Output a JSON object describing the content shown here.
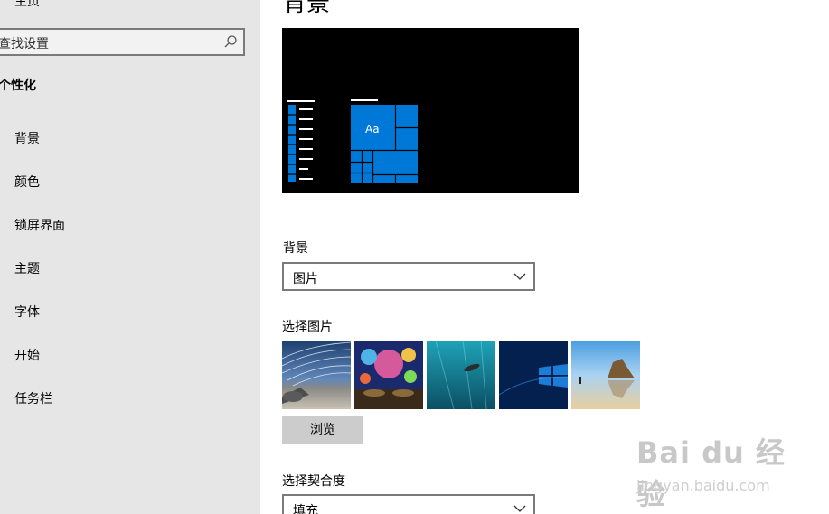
{
  "sidebar": {
    "home_label": "主页",
    "search_placeholder": "查找设置",
    "section_title": "个性化",
    "items": [
      {
        "label": "背景"
      },
      {
        "label": "颜色"
      },
      {
        "label": "锁屏界面"
      },
      {
        "label": "主题"
      },
      {
        "label": "字体"
      },
      {
        "label": "开始"
      },
      {
        "label": "任务栏"
      }
    ]
  },
  "main": {
    "title": "背景",
    "preview": {
      "tile_text": "Aa",
      "accent": "#0078d7"
    },
    "background": {
      "label": "背景",
      "value": "图片"
    },
    "choose_picture": {
      "label": "选择图片",
      "thumbnails": [
        "streaks-desert-thumbnail",
        "space-planets-thumbnail",
        "underwater-diver-thumbnail",
        "windows-logo-thumbnail",
        "beach-rocks-thumbnail"
      ]
    },
    "browse_label": "浏览",
    "fit": {
      "label": "选择契合度",
      "value": "填充"
    }
  },
  "watermark": {
    "logo": "Bai du 经验",
    "url": "jingyan.baidu.com"
  }
}
